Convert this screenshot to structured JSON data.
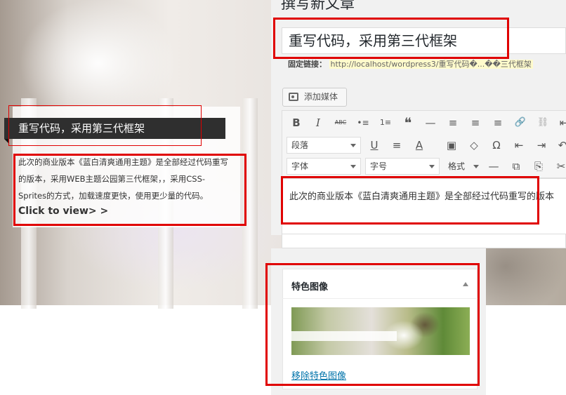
{
  "left_card": {
    "title": "重写代码，采用第三代框架",
    "description": "此次的商业版本《蓝白清爽通用主题》是全部经过代码重写的版本，采用WEB主题公园第三代框架，，采用CSS-Sprites的方式，加载速度更快，使用更少量的代码。",
    "link_text": "Click to view> >"
  },
  "editor": {
    "heading": "撰写新文章",
    "post_title": "重写代码，采用第三代框架",
    "permalink_label": "固定链接：",
    "permalink_url": "http://localhost/wordpress3/重写代码�...��三代框架",
    "add_media_label": "添加媒体",
    "toolbar_row1": [
      "B",
      "I",
      "ABC",
      "•≡",
      "1≡",
      "❝",
      "—",
      "≡",
      "≡",
      "≡",
      "🔗",
      "⛓",
      "⇤"
    ],
    "format_select": "段落",
    "font_select": "字体",
    "size_select": "字号",
    "format_menu": "格式",
    "toolbar_row2": [
      "U",
      "≡",
      "A",
      "▣",
      "◇",
      "Ω",
      "⇤",
      "⇥",
      "↶"
    ],
    "toolbar_row3": [
      "—",
      "⧉",
      "⎘",
      "✂"
    ],
    "content": "此次的商业版本《蓝白清爽通用主题》是全部经过代码重写的版本"
  },
  "featured_image": {
    "title": "特色图像",
    "remove_link": "移除特色图像"
  },
  "colors": {
    "highlight_red": "#e00000",
    "link_blue": "#0073aa",
    "title_bar_dark": "#2f2f2f"
  }
}
